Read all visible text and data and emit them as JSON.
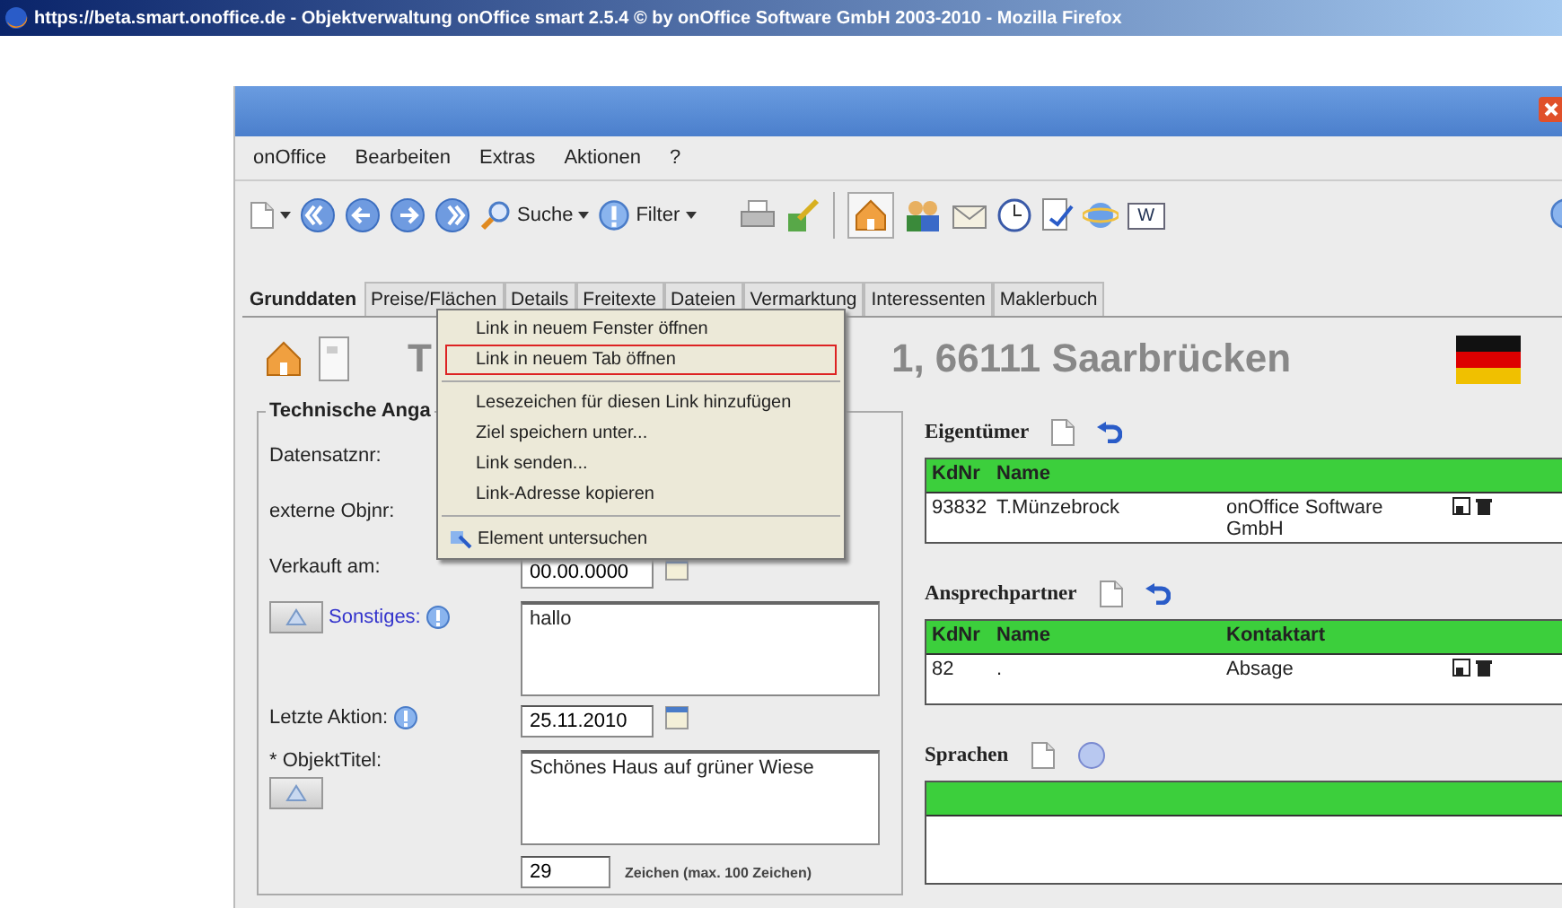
{
  "browser": {
    "title": "https://beta.smart.onoffice.de - Objektverwaltung onOffice smart 2.5.4 © by onOffice Software GmbH 2003-2010 - Mozilla Firefox"
  },
  "menu": [
    "onOffice",
    "Bearbeiten",
    "Extras",
    "Aktionen",
    "?"
  ],
  "toolbar": {
    "search_label": "Suche",
    "filter_label": "Filter",
    "word_label": "W"
  },
  "tabs": [
    {
      "label": "Grunddaten",
      "selected": true
    },
    {
      "label": "Preise/Flächen",
      "selected": false
    },
    {
      "label": "Details",
      "selected": false
    },
    {
      "label": "Freitexte",
      "selected": false
    },
    {
      "label": "Dateien",
      "selected": false
    },
    {
      "label": "Vermarktung",
      "selected": false
    },
    {
      "label": "Interessenten",
      "selected": false
    },
    {
      "label": "Maklerbuch",
      "selected": false
    }
  ],
  "heading": {
    "start": "T",
    "end": "1, 66111 Saarbrücken"
  },
  "technical": {
    "legend": "Technische Anga",
    "datensatznr_label": "Datensatznr:",
    "externe_objnr_label": "externe Objnr:",
    "verkauft_label": "Verkauft am:",
    "verkauft_value": "00.00.0000",
    "sonstiges_label": "Sonstiges:",
    "sonstiges_value": "hallo",
    "letzte_aktion_label": "Letzte Aktion:",
    "letzte_aktion_value": "25.11.2010",
    "objekttitel_label": "* ObjektTitel:",
    "objekttitel_value": "Schönes Haus auf grüner Wiese",
    "count_value": "29",
    "count_note": "Zeichen (max. 100 Zeichen)"
  },
  "owners": {
    "title": "Eigentümer",
    "columns": [
      "KdNr",
      "Name",
      ""
    ],
    "rows": [
      [
        "93832",
        "T.Münzebrock",
        "onOffice Software GmbH"
      ]
    ]
  },
  "contacts": {
    "title": "Ansprechpartner",
    "columns": [
      "KdNr",
      "Name",
      "Kontaktart"
    ],
    "rows": [
      [
        "82",
        ".",
        "Absage"
      ]
    ]
  },
  "languages": {
    "title": "Sprachen"
  },
  "context_menu": [
    {
      "kind": "item",
      "label": "Link in neuem Fenster öffnen",
      "selected": false
    },
    {
      "kind": "item",
      "label": "Link in neuem Tab öffnen",
      "selected": true
    },
    {
      "kind": "separator"
    },
    {
      "kind": "item",
      "label": "Lesezeichen für diesen Link hinzufügen",
      "selected": false
    },
    {
      "kind": "item",
      "label": "Ziel speichern unter...",
      "selected": false
    },
    {
      "kind": "item",
      "label": "Link senden...",
      "selected": false
    },
    {
      "kind": "item",
      "label": "Link-Adresse kopieren",
      "selected": false
    },
    {
      "kind": "separator"
    },
    {
      "kind": "inspect",
      "label": "Element untersuchen",
      "selected": false
    }
  ]
}
